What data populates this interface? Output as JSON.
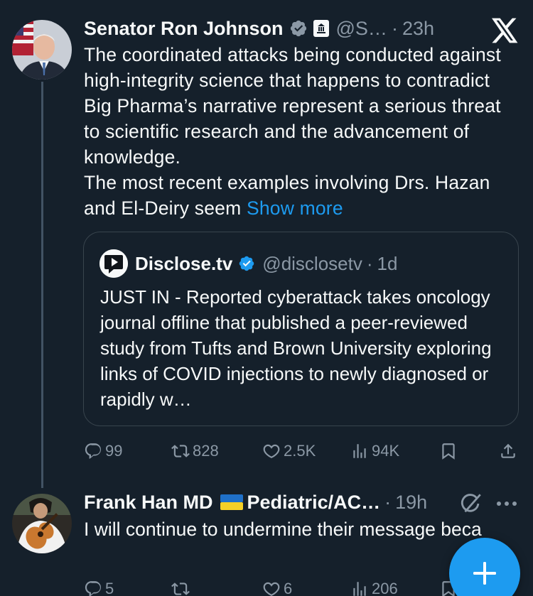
{
  "post": {
    "author_name": "Senator Ron Johnson",
    "handle": "@S…",
    "separator": "·",
    "time": "23h",
    "text_para1": "The coordinated attacks being conducted against high-integrity science that happens to contradict Big Pharma’s narrative represent a serious threat to scientific research and the advancement of knowledge.",
    "text_para2": "The most recent examples involving Drs. Hazan and El-Deiry seem ",
    "show_more": "Show more",
    "quote": {
      "author_name": "Disclose.tv",
      "handle": "@disclosetv",
      "separator": "·",
      "time": "1d",
      "text": "JUST IN - Reported cyberattack takes oncology journal offline that published a peer-reviewed study from Tufts and Brown University exploring links of COVID injections to newly diagnosed or rapidly w…"
    },
    "stats": {
      "replies": "99",
      "reposts": "828",
      "likes": "2.5K",
      "views": "94K"
    }
  },
  "reply": {
    "author_name": "Frank Han MD",
    "flag_label": "Ukraine flag",
    "author_suffix": "Pediatric/AC…",
    "separator": "·",
    "time": "19h",
    "text": "I will continue to undermine their message because they are wrong. As simple as th",
    "stats": {
      "replies": "5",
      "likes": "6",
      "views": "206"
    }
  },
  "colors": {
    "background": "#15202b",
    "text": "#f7f9f9",
    "muted": "#8b98a5",
    "accent": "#1d9bf0",
    "border": "#38444d"
  },
  "icons": [
    "x-logo-icon",
    "verified-badge-icon",
    "government-badge-icon",
    "reply-icon",
    "repost-icon",
    "like-icon",
    "views-icon",
    "bookmark-icon",
    "share-icon",
    "grok-icon",
    "more-icon",
    "compose-plus-icon"
  ]
}
